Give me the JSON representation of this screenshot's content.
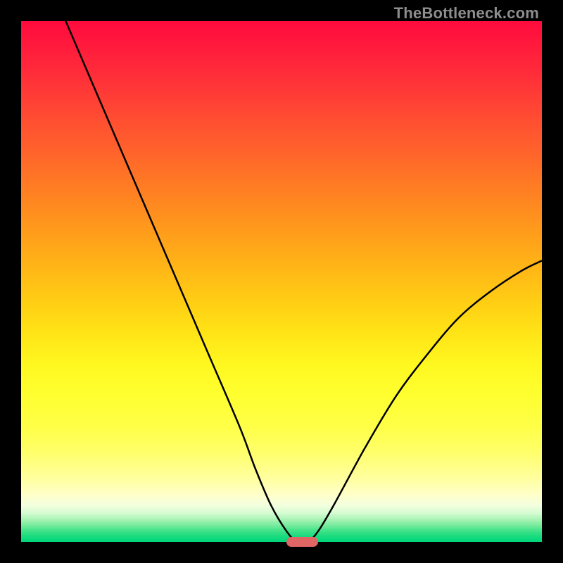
{
  "watermark_text": "TheBottleneck.com",
  "chart_data": {
    "type": "line",
    "title": "",
    "xlabel": "",
    "ylabel": "",
    "watermark": "TheBottleneck.com",
    "xlim": [
      0,
      100
    ],
    "ylim": [
      0,
      100
    ],
    "x": [
      0,
      6,
      12,
      18,
      24,
      30,
      36,
      42,
      45,
      48,
      51,
      53,
      55,
      57,
      60,
      66,
      72,
      78,
      84,
      90,
      96,
      100
    ],
    "values": [
      120,
      106,
      92,
      78,
      64,
      50,
      36,
      22,
      14,
      7,
      2,
      0,
      0,
      2,
      7,
      18,
      28,
      36,
      43,
      48,
      52,
      54
    ],
    "optimum": {
      "x_center": 54,
      "width": 6,
      "y": 0
    },
    "marker_color": "#e06666",
    "gradient_stops": [
      {
        "pos": 0.0,
        "color": "#ff0b3d"
      },
      {
        "pos": 0.06,
        "color": "#ff1f3c"
      },
      {
        "pos": 0.12,
        "color": "#ff3438"
      },
      {
        "pos": 0.18,
        "color": "#ff4a32"
      },
      {
        "pos": 0.24,
        "color": "#ff602c"
      },
      {
        "pos": 0.3,
        "color": "#ff7625"
      },
      {
        "pos": 0.36,
        "color": "#ff8c1f"
      },
      {
        "pos": 0.42,
        "color": "#ffa21a"
      },
      {
        "pos": 0.48,
        "color": "#ffb816"
      },
      {
        "pos": 0.54,
        "color": "#ffce14"
      },
      {
        "pos": 0.6,
        "color": "#ffe416"
      },
      {
        "pos": 0.66,
        "color": "#fff820"
      },
      {
        "pos": 0.72,
        "color": "#ffff30"
      },
      {
        "pos": 0.78,
        "color": "#ffff48"
      },
      {
        "pos": 0.83,
        "color": "#ffff6c"
      },
      {
        "pos": 0.88,
        "color": "#ffffa0"
      },
      {
        "pos": 0.91,
        "color": "#ffffc8"
      },
      {
        "pos": 0.93,
        "color": "#f4ffde"
      },
      {
        "pos": 0.945,
        "color": "#d8fcd4"
      },
      {
        "pos": 0.957,
        "color": "#aef4b8"
      },
      {
        "pos": 0.968,
        "color": "#7eeca0"
      },
      {
        "pos": 0.978,
        "color": "#4be48c"
      },
      {
        "pos": 0.988,
        "color": "#22dc80"
      },
      {
        "pos": 1.0,
        "color": "#00d67a"
      }
    ]
  }
}
